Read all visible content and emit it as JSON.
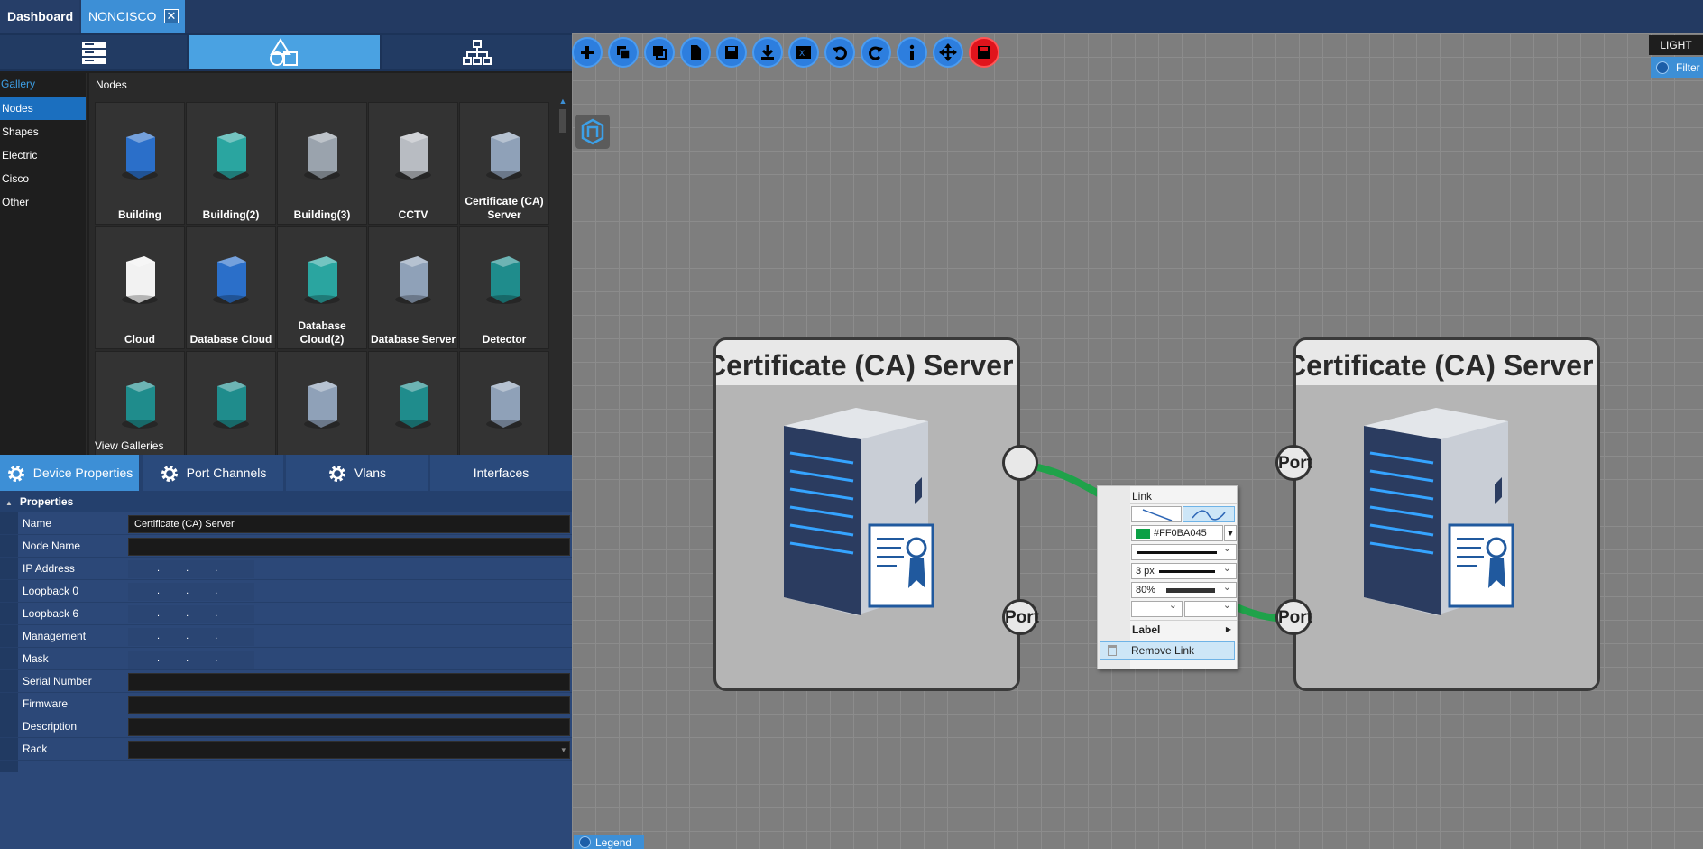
{
  "tabs": {
    "dashboard": "Dashboard",
    "active": "NONCISCO",
    "close": "✕"
  },
  "gallery": {
    "title": "Gallery",
    "nav": [
      "Nodes",
      "Shapes",
      "Electric",
      "Cisco",
      "Other"
    ],
    "header": "Nodes",
    "items": [
      {
        "label": "Building"
      },
      {
        "label": "Building(2)"
      },
      {
        "label": "Building(3)"
      },
      {
        "label": "CCTV"
      },
      {
        "label": "Certificate (CA) Server"
      },
      {
        "label": "Cloud"
      },
      {
        "label": "Database Cloud"
      },
      {
        "label": "Database Cloud(2)"
      },
      {
        "label": "Database Server"
      },
      {
        "label": "Detector"
      },
      {
        "label": ""
      },
      {
        "label": ""
      },
      {
        "label": ""
      },
      {
        "label": ""
      },
      {
        "label": ""
      }
    ],
    "view_galleries": "View Galleries"
  },
  "prop_tabs": [
    "Device Properties",
    "Port Channels",
    "Vlans",
    "Interfaces"
  ],
  "properties": {
    "section": "Properties",
    "rows": [
      {
        "key": "Name",
        "value": "Certificate (CA) Server",
        "type": "text"
      },
      {
        "key": "Node Name",
        "value": "",
        "type": "text"
      },
      {
        "key": "IP Address",
        "value": ". . .",
        "type": "ip"
      },
      {
        "key": "Loopback 0",
        "value": ". . .",
        "type": "ip"
      },
      {
        "key": "Loopback 6",
        "value": ". . .",
        "type": "ip"
      },
      {
        "key": "Management",
        "value": ". . .",
        "type": "ip"
      },
      {
        "key": "Mask",
        "value": ". . .",
        "type": "ip"
      },
      {
        "key": "Serial Number",
        "value": "",
        "type": "text"
      },
      {
        "key": "Firmware",
        "value": "",
        "type": "text"
      },
      {
        "key": "Description",
        "value": "",
        "type": "text"
      },
      {
        "key": "Rack",
        "value": "",
        "type": "combo"
      }
    ]
  },
  "canvas": {
    "theme_button": "LIGHT",
    "filter_button": "Filter",
    "legend_button": "Legend",
    "toolbar_icons": [
      "add-icon",
      "copy-icon",
      "duplicate-icon",
      "new-page-icon",
      "save-icon",
      "download-icon",
      "excel-export-icon",
      "undo-icon",
      "redo-icon",
      "info-icon",
      "move-icon",
      "red-save-icon"
    ],
    "nodes": [
      {
        "title": "Certificate (CA) Server"
      },
      {
        "title": "Certificate (CA) Server"
      }
    ],
    "port_label": "Port",
    "link_color": "#1fa24a"
  },
  "link_menu": {
    "title": "Link",
    "color_value": "#FF0BA045",
    "color_swatch": "#0ba045",
    "width": "3 px",
    "opacity": "80%",
    "label": "Label",
    "remove": "Remove Link"
  }
}
